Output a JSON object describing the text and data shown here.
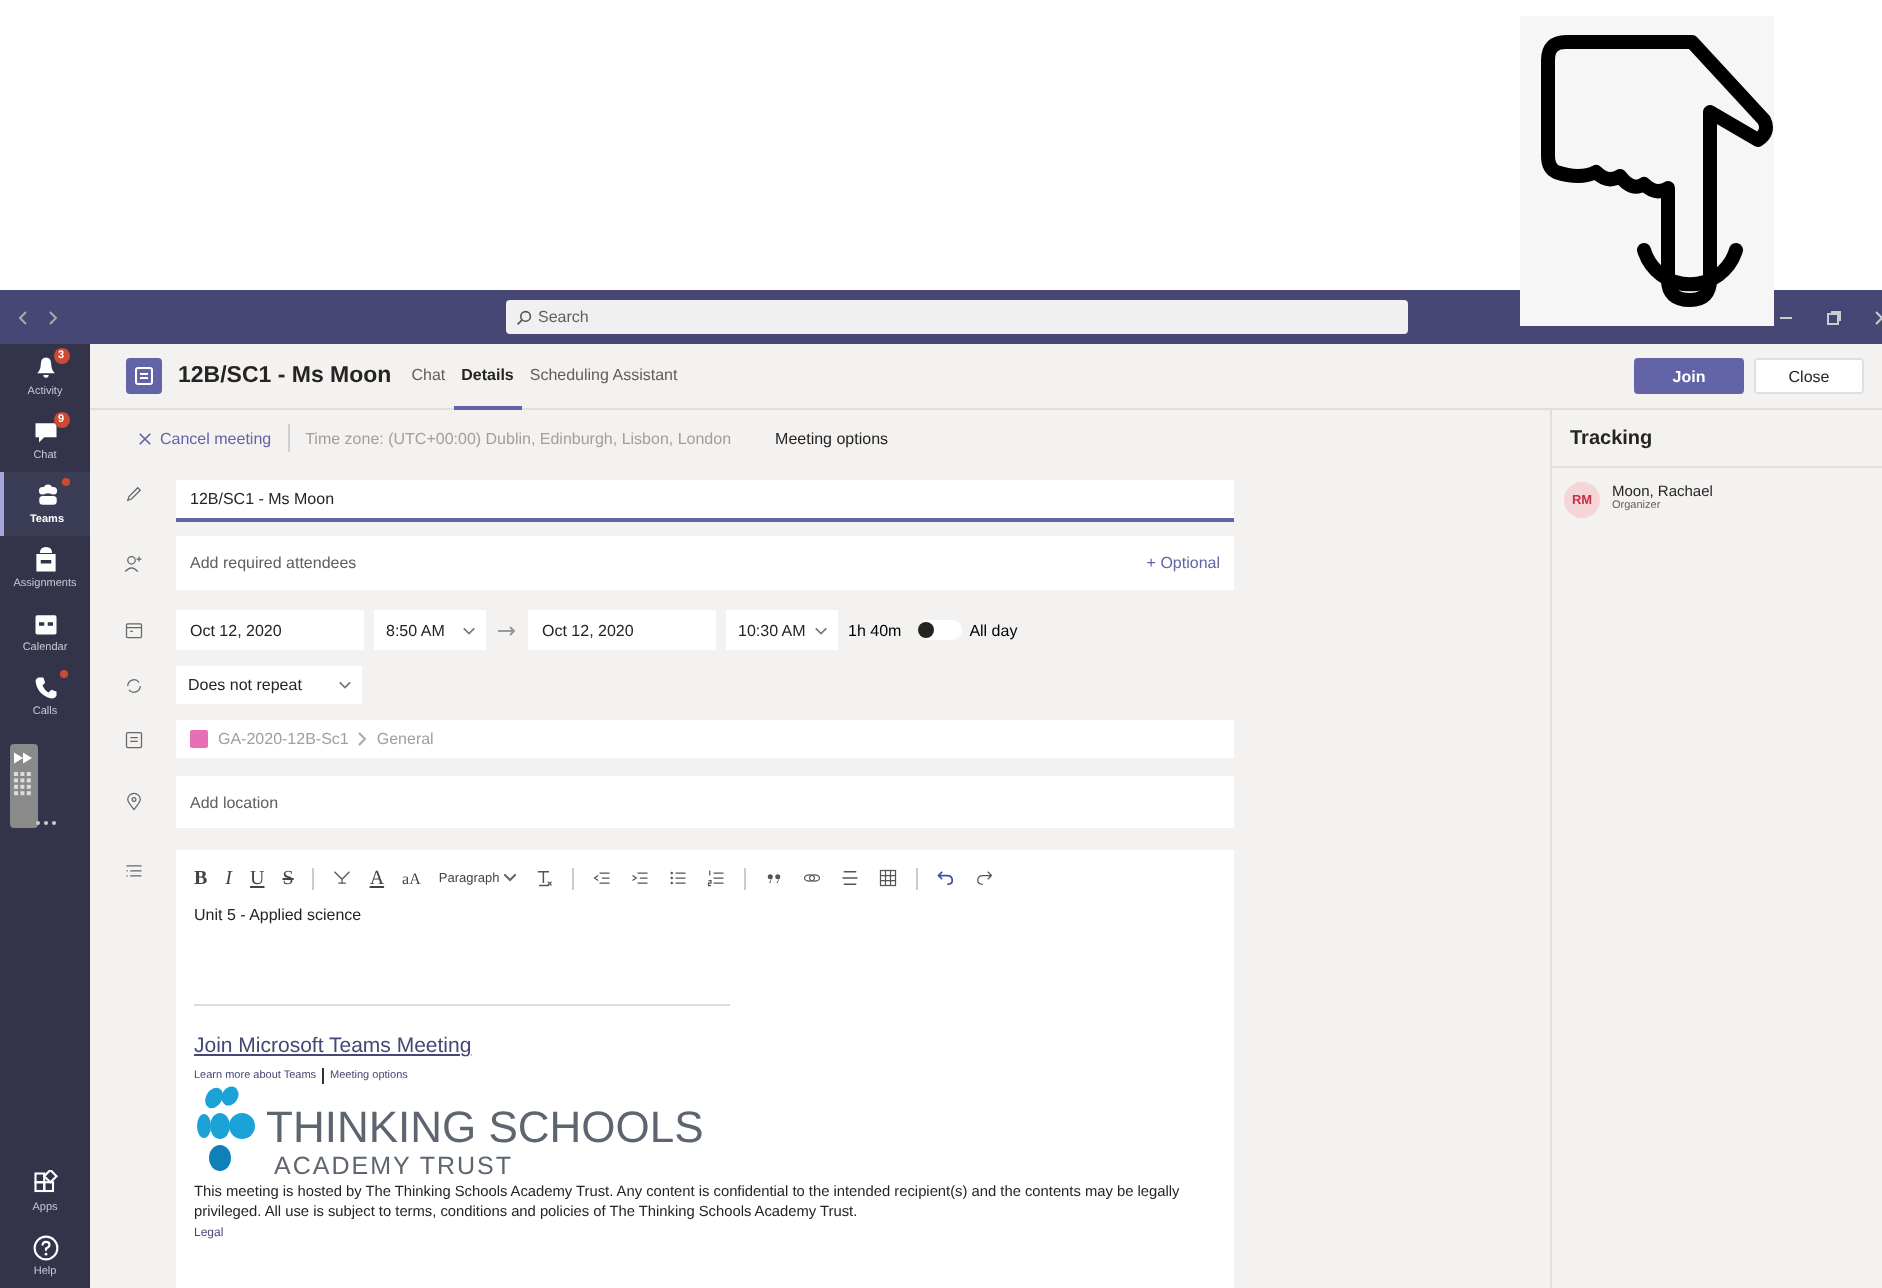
{
  "title_bar": {
    "search": {
      "placeholder": "Search"
    }
  },
  "rail": {
    "items": [
      {
        "kind": "bell",
        "label": "Activity",
        "badge": "3",
        "unread": false,
        "selected": false
      },
      {
        "kind": "chat",
        "label": "Chat",
        "badge": "9",
        "unread": false,
        "selected": false
      },
      {
        "kind": "teams",
        "label": "Teams",
        "unread": true,
        "selected": true
      },
      {
        "kind": "bag",
        "label": "Assignments",
        "unread": false,
        "selected": false
      },
      {
        "kind": "calendar",
        "label": "Calendar",
        "unread": false,
        "selected": false
      },
      {
        "kind": "phone",
        "label": "Calls",
        "unread": true,
        "selected": false
      }
    ],
    "bottom_items": [
      {
        "kind": "apps",
        "label": "Apps",
        "unread": false,
        "selected": false
      },
      {
        "kind": "help",
        "label": "Help",
        "unread": false,
        "selected": false
      }
    ]
  },
  "meeting": {
    "title": "12B/SC1 - Ms Moon",
    "tabs": [
      {
        "label": "Chat",
        "selected": false
      },
      {
        "label": "Details",
        "selected": true
      },
      {
        "label": "Scheduling Assistant",
        "selected": false
      }
    ],
    "buttons": [
      {
        "label": "Join",
        "kind": "primary"
      },
      {
        "label": "Close",
        "kind": "secondary"
      }
    ]
  },
  "commands": {
    "cancel": "Cancel meeting",
    "time_zone": "Time zone: (UTC+00:00) Dublin, Edinburgh, Lisbon, London",
    "meeting_options": "Meeting options"
  },
  "form": {
    "title": "12B/SC1 - Ms Moon",
    "attendees": {
      "placeholder": "Add required attendees",
      "optional": "+ Optional"
    },
    "start_date": "Oct 12, 2020",
    "start_time": "8:50 AM",
    "end_date": "Oct 12, 2020",
    "end_time": "10:30 AM",
    "duration": "1h 40m",
    "all_day": {
      "label": "All day",
      "on": false
    },
    "repeat": "Does not repeat",
    "channel": {
      "team": "GA-2020-12B-Sc1",
      "channel": "General"
    },
    "location": {
      "placeholder": "Add location"
    }
  },
  "editor": {
    "toolbar": [
      {
        "kind": "bold",
        "label": "B"
      },
      {
        "kind": "italic",
        "label": "I"
      },
      {
        "kind": "underline",
        "label": "U"
      },
      {
        "kind": "strike",
        "label": "S"
      },
      {
        "kind": "divider"
      },
      {
        "kind": "highlight"
      },
      {
        "kind": "font-color",
        "label": "A"
      },
      {
        "kind": "font-size",
        "label": "aA"
      },
      {
        "kind": "dropdown",
        "label": "Paragraph"
      },
      {
        "kind": "clear-format"
      },
      {
        "kind": "divider"
      },
      {
        "kind": "outdent"
      },
      {
        "kind": "indent"
      },
      {
        "kind": "bullets"
      },
      {
        "kind": "numbers"
      },
      {
        "kind": "divider"
      },
      {
        "kind": "quote"
      },
      {
        "kind": "link"
      },
      {
        "kind": "rule"
      },
      {
        "kind": "table"
      },
      {
        "kind": "divider"
      },
      {
        "kind": "undo"
      },
      {
        "kind": "redo"
      }
    ],
    "body": "Unit 5 - Applied science",
    "join_link": "Join Microsoft Teams Meeting",
    "links": [
      "Learn more about Teams",
      "Meeting options"
    ],
    "logo": {
      "title": "THINKING SCHOOLS",
      "subtitle": "ACADEMY TRUST"
    },
    "disclaimer": "This meeting is hosted by The Thinking Schools Academy Trust. Any content is confidential to the intended recipient(s) and the contents may be legally privileged. All use is subject to terms, conditions and policies of The Thinking Schools Academy Trust.",
    "legal": "Legal"
  },
  "tracking": {
    "title": "Tracking",
    "people": [
      {
        "initials": "RM",
        "name": "Moon, Rachael",
        "role": "Organizer"
      }
    ]
  }
}
